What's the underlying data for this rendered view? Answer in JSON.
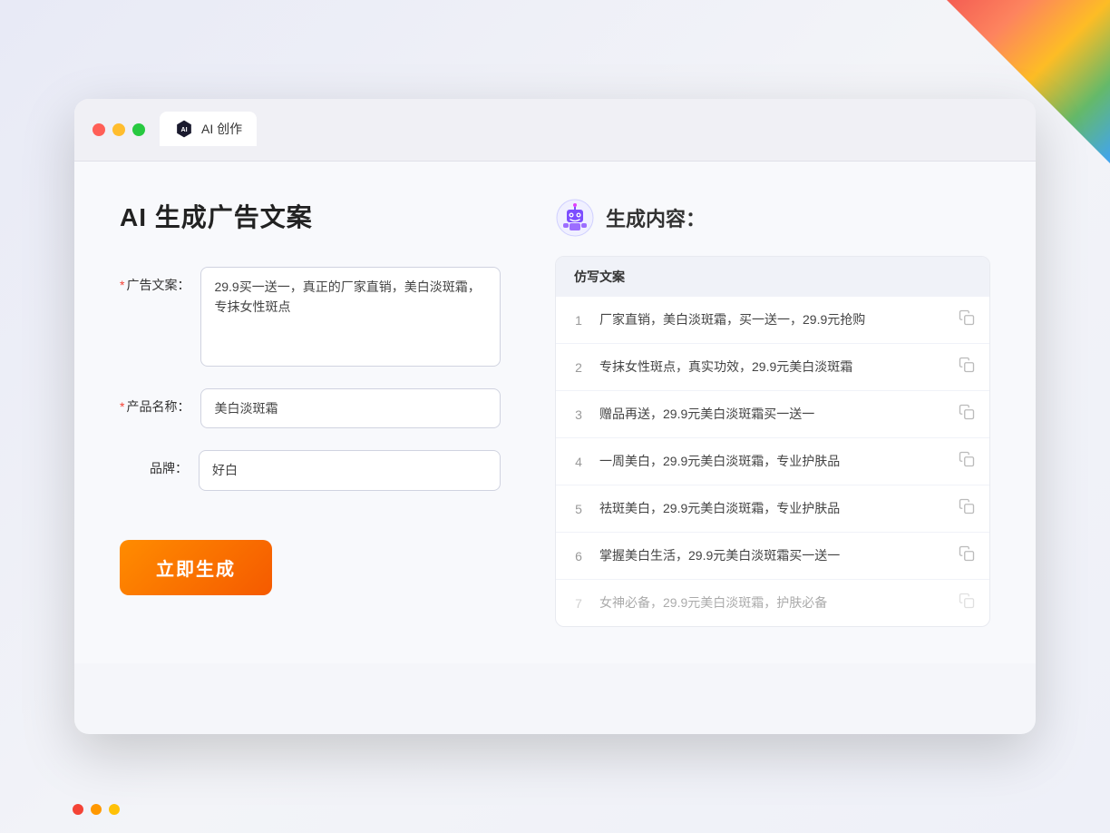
{
  "browser": {
    "tab_icon_text": "AI",
    "tab_title": "AI 创作"
  },
  "left_panel": {
    "page_title": "AI 生成广告文案",
    "form": {
      "ad_copy_label": "广告文案：",
      "ad_copy_required": "*",
      "ad_copy_value": "29.9买一送一，真正的厂家直销，美白淡斑霜，专抹女性斑点",
      "product_name_label": "产品名称：",
      "product_name_required": "*",
      "product_name_value": "美白淡斑霜",
      "brand_label": "品牌：",
      "brand_value": "好白"
    },
    "generate_button": "立即生成"
  },
  "right_panel": {
    "title": "生成内容：",
    "table_header": "仿写文案",
    "results": [
      {
        "num": "1",
        "text": "厂家直销，美白淡斑霜，买一送一，29.9元抢购",
        "faded": false
      },
      {
        "num": "2",
        "text": "专抹女性斑点，真实功效，29.9元美白淡斑霜",
        "faded": false
      },
      {
        "num": "3",
        "text": "赠品再送，29.9元美白淡斑霜买一送一",
        "faded": false
      },
      {
        "num": "4",
        "text": "一周美白，29.9元美白淡斑霜，专业护肤品",
        "faded": false
      },
      {
        "num": "5",
        "text": "祛斑美白，29.9元美白淡斑霜，专业护肤品",
        "faded": false
      },
      {
        "num": "6",
        "text": "掌握美白生活，29.9元美白淡斑霜买一送一",
        "faded": false
      },
      {
        "num": "7",
        "text": "女神必备，29.9元美白淡斑霜，护肤必备",
        "faded": true
      }
    ]
  },
  "colors": {
    "accent": "#f55a00",
    "required": "#f44336",
    "robot_primary": "#7c4dff",
    "robot_secondary": "#e040fb"
  }
}
